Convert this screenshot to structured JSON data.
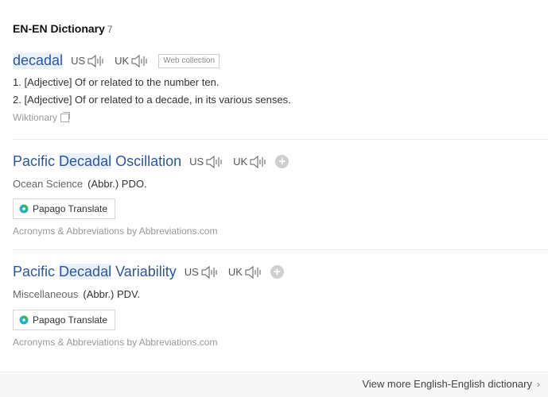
{
  "header": {
    "title": "EN-EN Dictionary",
    "count": "7"
  },
  "entries": [
    {
      "word": "decadal",
      "us_label": "US",
      "uk_label": "UK",
      "badge": "Web collection",
      "definitions": [
        "1. [Adjective] Of or related to the number ten.",
        "2. [Adjective] Of or related to a decade, in its various senses."
      ],
      "source": "Wiktionary"
    },
    {
      "word_pre": "Pacific ",
      "word_hl": "Decadal",
      "word_post": " Oscillation",
      "us_label": "US",
      "uk_label": "UK",
      "subject": "Ocean Science",
      "abbr": "(Abbr.) PDO.",
      "translate": "Papago Translate",
      "source": "Acronyms & Abbreviations by Abbreviations.com"
    },
    {
      "word_pre": "Pacific ",
      "word_hl": "Decadal",
      "word_post": " Variability",
      "us_label": "US",
      "uk_label": "UK",
      "subject": "Miscellaneous",
      "abbr": "(Abbr.) PDV.",
      "translate": "Papago Translate",
      "source": "Acronyms & Abbreviations by Abbreviations.com"
    }
  ],
  "footer": {
    "more": "View more English-English dictionary"
  },
  "colors": {
    "link": "#2a56a6",
    "highlight": "#e9f1fb"
  },
  "icons": {
    "speaker": "speaker-icon",
    "plus": "plus-icon",
    "papago": "papago-logo-icon",
    "chevron": "chevron-right-icon"
  }
}
